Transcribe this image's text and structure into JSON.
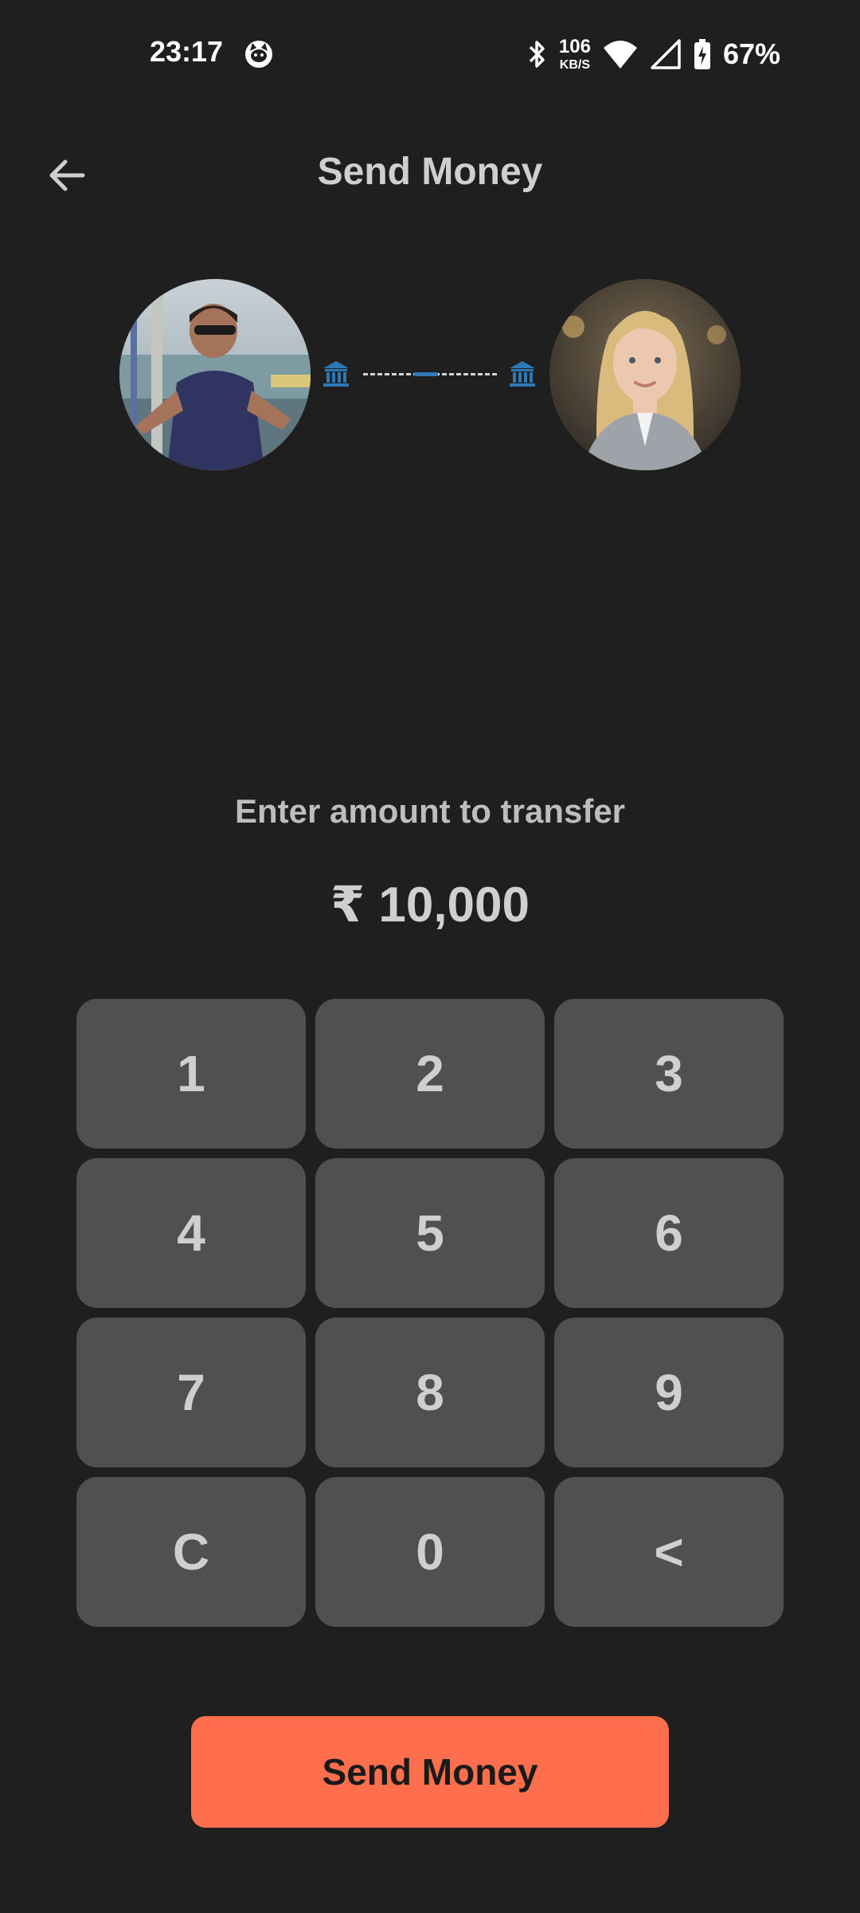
{
  "status_bar": {
    "time": "23:17",
    "net_speed_value": "106",
    "net_speed_unit": "KB/S",
    "battery_percent": "67%"
  },
  "header": {
    "title": "Send Money",
    "back_icon": "arrow-left-icon"
  },
  "transfer": {
    "sender_avatar": "avatar-photo-man",
    "recipient_avatar": "avatar-photo-woman",
    "bank_icon": "bank-icon",
    "accent_color": "#2f78b6"
  },
  "amount_section": {
    "prompt": "Enter amount to transfer",
    "amount": "₹ 10,000"
  },
  "keypad": {
    "keys": [
      "1",
      "2",
      "3",
      "4",
      "5",
      "6",
      "7",
      "8",
      "9",
      "C",
      "0",
      "<"
    ]
  },
  "primary_action": {
    "label": "Send Money",
    "color": "#ff6f4d"
  }
}
